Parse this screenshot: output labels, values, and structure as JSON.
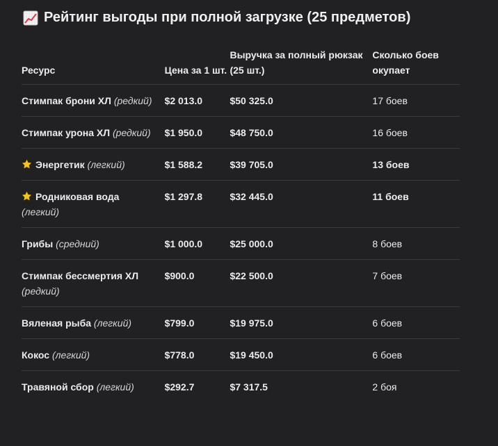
{
  "title": "Рейтинг выгоды при полной загрузке (25 предметов)",
  "title_icon": "chart-increasing-icon",
  "columns": [
    "Ресурс",
    "Цена за 1 шт.",
    "Выручка за полный рюкзак (25 шт.)",
    "Сколько боев окупает"
  ],
  "rows": [
    {
      "name": "Стимпак брони ХЛ",
      "note": "(редкий)",
      "star": false,
      "price": "$2 013.0",
      "revenue": "$50 325.0",
      "battles": "17 боев",
      "highlight": false
    },
    {
      "name": "Стимпак урона ХЛ",
      "note": "(редкий)",
      "star": false,
      "price": "$1 950.0",
      "revenue": "$48 750.0",
      "battles": "16 боев",
      "highlight": false
    },
    {
      "name": "Энергетик",
      "note": "(легкий)",
      "star": true,
      "price": "$1 588.2",
      "revenue": "$39 705.0",
      "battles": "13 боев",
      "highlight": true
    },
    {
      "name": "Родниковая вода",
      "note": "(легкий)",
      "star": true,
      "price": "$1 297.8",
      "revenue": "$32 445.0",
      "battles": "11 боев",
      "highlight": true
    },
    {
      "name": "Грибы",
      "note": "(средний)",
      "star": false,
      "price": "$1 000.0",
      "revenue": "$25 000.0",
      "battles": "8 боев",
      "highlight": false
    },
    {
      "name": "Стимпак бессмертия ХЛ",
      "note": "(редкий)",
      "star": false,
      "price": "$900.0",
      "revenue": "$22 500.0",
      "battles": "7 боев",
      "highlight": false
    },
    {
      "name": "Вяленая рыба",
      "note": "(легкий)",
      "star": false,
      "price": "$799.0",
      "revenue": "$19 975.0",
      "battles": "6 боев",
      "highlight": false
    },
    {
      "name": "Кокос",
      "note": "(легкий)",
      "star": false,
      "price": "$778.0",
      "revenue": "$19 450.0",
      "battles": "6 боев",
      "highlight": false
    },
    {
      "name": "Травяной сбор",
      "note": "(легкий)",
      "star": false,
      "price": "$292.7",
      "revenue": "$7 317.5",
      "battles": "2 боя",
      "highlight": false
    }
  ],
  "colors": {
    "background": "#212124",
    "text": "#ececec",
    "star": "#f5c518",
    "divider": "#3c3c40"
  }
}
